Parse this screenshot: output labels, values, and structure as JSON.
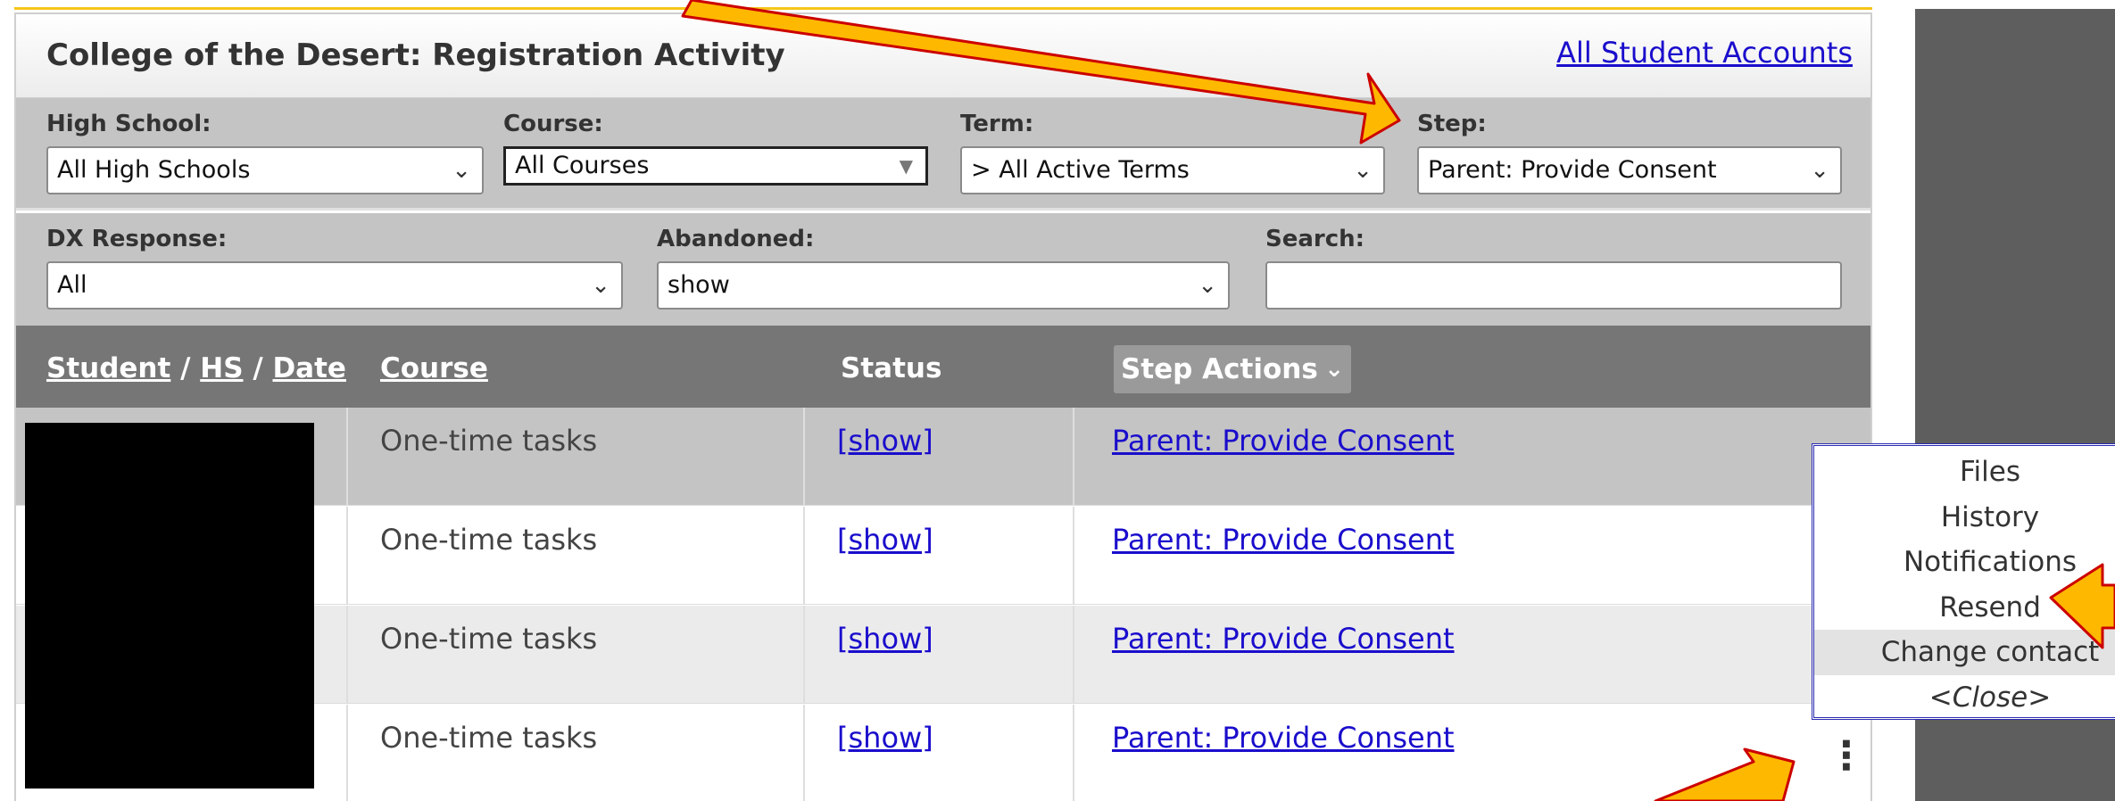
{
  "header": {
    "title": "College of the Desert: Registration Activity",
    "all_accounts_link": "All Student Accounts"
  },
  "filters": {
    "high_school": {
      "label": "High School:",
      "value": "All High Schools"
    },
    "course": {
      "label": "Course:",
      "value": "All Courses"
    },
    "term": {
      "label": "Term:",
      "value": "> All Active Terms"
    },
    "step": {
      "label": "Step:",
      "value": "Parent: Provide Consent"
    },
    "dx_response": {
      "label": "DX Response:",
      "value": "All"
    },
    "abandoned": {
      "label": "Abandoned:",
      "value": "show"
    },
    "search": {
      "label": "Search:",
      "value": ""
    }
  },
  "table": {
    "headers": {
      "student": "Student",
      "sep1": "/",
      "hs": "HS",
      "sep2": "/",
      "date": "Date",
      "course": "Course",
      "status": "Status",
      "step_actions": "Step Actions"
    },
    "rows": [
      {
        "course": "One-time tasks",
        "status": "[show]",
        "step": "Parent: Provide Consent"
      },
      {
        "course": "One-time tasks",
        "status": "[show]",
        "step": "Parent: Provide Consent"
      },
      {
        "course": "One-time tasks",
        "status": "[show]",
        "step": "Parent: Provide Consent"
      },
      {
        "course": "One-time tasks",
        "status": "[show]",
        "step": "Parent: Provide Consent"
      }
    ]
  },
  "context_menu": {
    "items": [
      "Files",
      "History",
      "Notifications",
      "Resend",
      "Change contact",
      "<Close>"
    ]
  },
  "icons": {
    "chevron": "chevron-down-icon",
    "kebab": "kebab-menu-icon",
    "arrow": "annotation-arrow"
  },
  "colors": {
    "accent_yellow": "#f5c518",
    "arrow_fill": "#ffb800",
    "arrow_stroke": "#cc0000",
    "link": "#1a0dcc",
    "header_gray": "#767676",
    "filter_gray": "#c4c4c4"
  }
}
